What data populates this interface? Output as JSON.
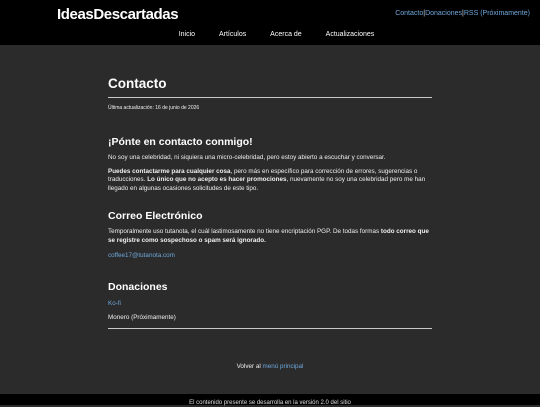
{
  "header": {
    "logo": "IdeasDescartadas",
    "top_links": [
      "Contacto",
      "Donaciones",
      "RSS (Próximamente)"
    ],
    "separator": "|",
    "nav": [
      "Inicio",
      "Artículos",
      "Acerca de",
      "Actualizaciones"
    ]
  },
  "page": {
    "title": "Contacto",
    "updated": "Última actualización: 16 de junio de 2026"
  },
  "section_contact": {
    "heading": "¡Pónte en contacto conmigo!",
    "p1": "No soy una celebridad, ni siquiera una micro-celebridad, pero estoy abierto a escuchar y conversar.",
    "p2_bold1": "Puedes contactarme para cualquier cosa",
    "p2_text1": ", pero más en específico para corrección de errores, sugerencias o traducciones. ",
    "p2_bold2": "Lo único que no acepto es hacer promociones",
    "p2_text2": ", nuevamente no soy una celebridad pero me han llegado en algunas ocasiones solicitudes de este tipo."
  },
  "section_email": {
    "heading": "Correo Electrónico",
    "text1": "Temporalmente uso tutanota, el cuál lastimosamente no tiene encriptación PGP. De todas formas ",
    "bold": "todo correo que se registre como sospechoso o spam será ignorado.",
    "email": "coffee17@tutanota.com"
  },
  "section_donations": {
    "heading": "Donaciones",
    "kofi": "Ko-fi",
    "monero": "Monero (Próximamente)"
  },
  "footer": {
    "back_text": "Volver al ",
    "back_link": "menú principal",
    "bottom_text": "El contenido presente se desarrolla en la versión 2.0 del sitio"
  }
}
